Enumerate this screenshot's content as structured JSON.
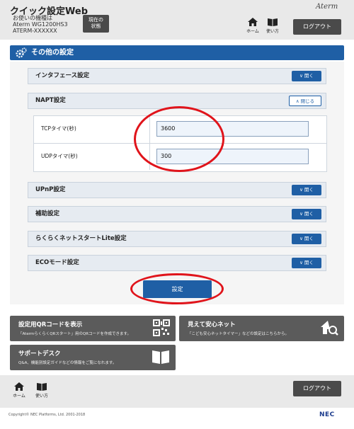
{
  "header": {
    "app_title": "クイック設定Web",
    "model_label": "お使いの機種は",
    "model_name": "Aterm WG1200HS3",
    "device_id": "ATERM-XXXXXX",
    "status_button_line1": "現在の",
    "status_button_line2": "状態",
    "brand": "Aterm",
    "home_label": "ホーム",
    "help_label": "使い方",
    "logout_label": "ログアウト"
  },
  "section": {
    "title": "その他の設定",
    "icon": "gear-icon"
  },
  "accordions": [
    {
      "label": "インタフェース設定",
      "button": "開く",
      "state": "closed"
    },
    {
      "label": "NAPT設定",
      "button": "閉じる",
      "state": "open"
    },
    {
      "label": "UPnP設定",
      "button": "開く",
      "state": "closed"
    },
    {
      "label": "補助設定",
      "button": "開く",
      "state": "closed"
    },
    {
      "label": "らくらくネットスタートLite設定",
      "button": "開く",
      "state": "closed"
    },
    {
      "label": "ECOモード設定",
      "button": "開く",
      "state": "closed"
    }
  ],
  "napt": {
    "tcp_label": "TCPタイマ(秒)",
    "tcp_value": "3600",
    "udp_label": "UDPタイマ(秒)",
    "udp_value": "300"
  },
  "save_label": "設定",
  "cards": {
    "qr": {
      "title": "設定用QRコードを表示",
      "desc": "「AtermらくらくQRスタート」用のQRコードを作成できます。",
      "icon": "qr-code-icon"
    },
    "safe_net": {
      "title": "見えて安心ネット",
      "desc": "「こども安心ネットタイマー」などの設定はこちらから。",
      "icon": "home-search-icon"
    },
    "support": {
      "title": "サポートデスク",
      "desc": "Q&A、機能別設定ガイドなどの情報をご覧になれます。",
      "icon": "book-icon"
    }
  },
  "footer": {
    "home_label": "ホーム",
    "help_label": "使い方",
    "logout_label": "ログアウト",
    "copyright": "Copyright© NEC Platforms, Ltd. 2001-2018",
    "logo": "NEC"
  },
  "colors": {
    "accent": "#1f5fa5",
    "highlight": "#e0141b",
    "card": "#5b5b5b"
  }
}
